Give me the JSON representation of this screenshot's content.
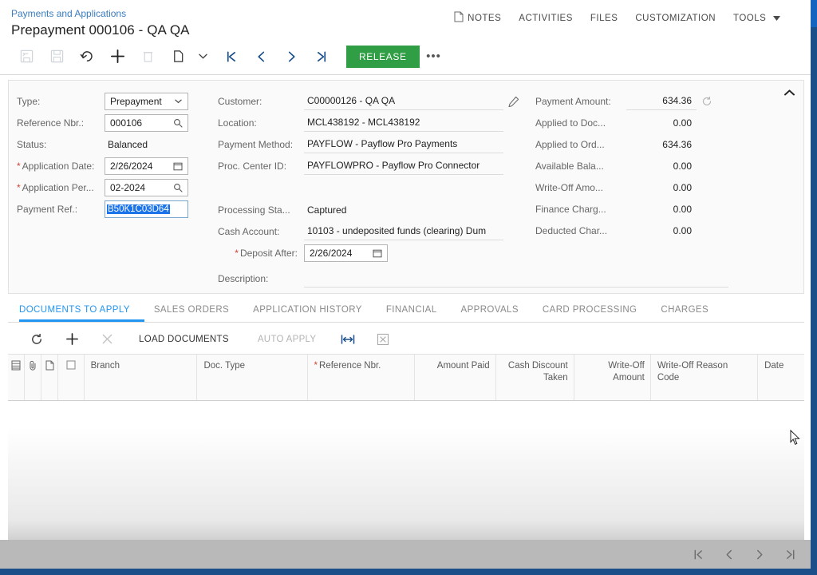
{
  "header": {
    "breadcrumb": "Payments and Applications",
    "title": "Prepayment 000106 - QA QA",
    "menu": [
      {
        "label": "NOTES",
        "icon": "note-icon"
      },
      {
        "label": "ACTIVITIES",
        "icon": ""
      },
      {
        "label": "FILES",
        "icon": ""
      },
      {
        "label": "CUSTOMIZATION",
        "icon": ""
      },
      {
        "label": "TOOLS",
        "icon": "caret-down-icon"
      }
    ]
  },
  "toolbar": {
    "icons": [
      {
        "name": "save-and-close-icon",
        "disabled": true
      },
      {
        "name": "save-icon",
        "disabled": true
      },
      {
        "name": "undo-icon",
        "disabled": false
      },
      {
        "name": "add-icon",
        "disabled": false
      },
      {
        "name": "delete-icon",
        "disabled": true
      },
      {
        "name": "copy-paste-icon",
        "disabled": false
      },
      {
        "name": "chevron-down-icon",
        "disabled": false
      },
      {
        "name": "first-record-icon",
        "disabled": false
      },
      {
        "name": "previous-record-icon",
        "disabled": false
      },
      {
        "name": "next-record-icon",
        "disabled": false
      },
      {
        "name": "last-record-icon",
        "disabled": false
      }
    ],
    "release_label": "RELEASE",
    "release_color": "#2f9e44",
    "more_label": "•••"
  },
  "form": {
    "left": [
      {
        "label": "Type:",
        "value": "Prepayment",
        "control": "dropdown",
        "required": false
      },
      {
        "label": "Reference Nbr.:",
        "value": "000106",
        "control": "lookup",
        "required": false
      },
      {
        "label": "Status:",
        "value": "Balanced",
        "control": "static",
        "required": false
      },
      {
        "label": "Application Date:",
        "value": "2/26/2024",
        "control": "date",
        "required": true
      },
      {
        "label": "Application Per...",
        "value": "02-2024",
        "control": "lookup",
        "required": true
      },
      {
        "label": "Payment Ref.:",
        "value": "B50K1C03D64",
        "control": "text-selected",
        "required": false
      }
    ],
    "middle": [
      {
        "label": "Customer:",
        "value": "C00000126 - QA QA",
        "control": "line-edit",
        "required": false
      },
      {
        "label": "Location:",
        "value": "MCL438192 - MCL438192",
        "control": "line",
        "required": false
      },
      {
        "label": "Payment Method:",
        "value": "PAYFLOW - Payflow Pro Payments",
        "control": "line",
        "required": false
      },
      {
        "label": "Proc. Center ID:",
        "value": "PAYFLOWPRO - Payflow Pro Connector",
        "control": "line",
        "required": false
      },
      {
        "label": "Processing Sta...",
        "value": "Captured",
        "control": "static",
        "required": false
      },
      {
        "label": "Cash Account:",
        "value": "10103 - undeposited funds (clearing) Dum",
        "control": "line",
        "required": false
      },
      {
        "label": "Deposit After:",
        "value": "2/26/2024",
        "control": "date",
        "required": true
      },
      {
        "label": "Description:",
        "value": "",
        "control": "line",
        "required": false
      }
    ],
    "right": [
      {
        "label": "Payment Amount:",
        "value": "634.36",
        "control": "line-refresh"
      },
      {
        "label": "Applied to Doc...",
        "value": "0.00",
        "control": "static-num"
      },
      {
        "label": "Applied to Ord...",
        "value": "634.36",
        "control": "static-num"
      },
      {
        "label": "Available Bala...",
        "value": "0.00",
        "control": "static-num"
      },
      {
        "label": "Write-Off Amo...",
        "value": "0.00",
        "control": "static-num"
      },
      {
        "label": "Finance Charg...",
        "value": "0.00",
        "control": "static-num"
      },
      {
        "label": "Deducted Char...",
        "value": "0.00",
        "control": "static-num"
      }
    ]
  },
  "tabs": [
    {
      "label": "DOCUMENTS TO APPLY",
      "active": true
    },
    {
      "label": "SALES ORDERS",
      "active": false
    },
    {
      "label": "APPLICATION HISTORY",
      "active": false
    },
    {
      "label": "FINANCIAL",
      "active": false
    },
    {
      "label": "APPROVALS",
      "active": false
    },
    {
      "label": "CARD PROCESSING",
      "active": false
    },
    {
      "label": "CHARGES",
      "active": false
    }
  ],
  "grid_toolbar": {
    "refresh_icon": "refresh-icon",
    "add_icon": "add-row-icon",
    "delete_icon": "delete-row-icon",
    "load_documents_label": "LOAD DOCUMENTS",
    "auto_apply_label": "AUTO APPLY",
    "fit_icon": "fit-columns-icon",
    "export_icon": "export-excel-icon"
  },
  "grid": {
    "columns": [
      {
        "label": "",
        "icon": "settings-columns-icon",
        "width": 22,
        "align": "center"
      },
      {
        "label": "",
        "icon": "attachment-icon",
        "width": 22,
        "align": "center"
      },
      {
        "label": "",
        "icon": "note-icon",
        "width": 22,
        "align": "center"
      },
      {
        "label": "",
        "icon": "checkbox-icon",
        "width": 34,
        "align": "center"
      },
      {
        "label": "Branch",
        "icon": "",
        "width": 148,
        "align": "left"
      },
      {
        "label": "Doc. Type",
        "icon": "",
        "width": 144,
        "align": "left"
      },
      {
        "label": "Reference Nbr.",
        "icon": "",
        "width": 140,
        "align": "left",
        "required": true
      },
      {
        "label": "Amount Paid",
        "icon": "",
        "width": 106,
        "align": "right"
      },
      {
        "label": "Cash Discount Taken",
        "icon": "",
        "width": 102,
        "align": "right"
      },
      {
        "label": "Write-Off Amount",
        "icon": "",
        "width": 100,
        "align": "right"
      },
      {
        "label": "Write-Off Reason Code",
        "icon": "",
        "width": 140,
        "align": "left"
      },
      {
        "label": "Date",
        "icon": "",
        "width": 60,
        "align": "left"
      }
    ],
    "rows": []
  },
  "pager": {
    "buttons": [
      {
        "name": "first-page-button",
        "glyph": "|‹"
      },
      {
        "name": "previous-page-button",
        "glyph": "‹"
      },
      {
        "name": "next-page-button",
        "glyph": "›"
      },
      {
        "name": "last-page-button",
        "glyph": "›|"
      }
    ]
  }
}
